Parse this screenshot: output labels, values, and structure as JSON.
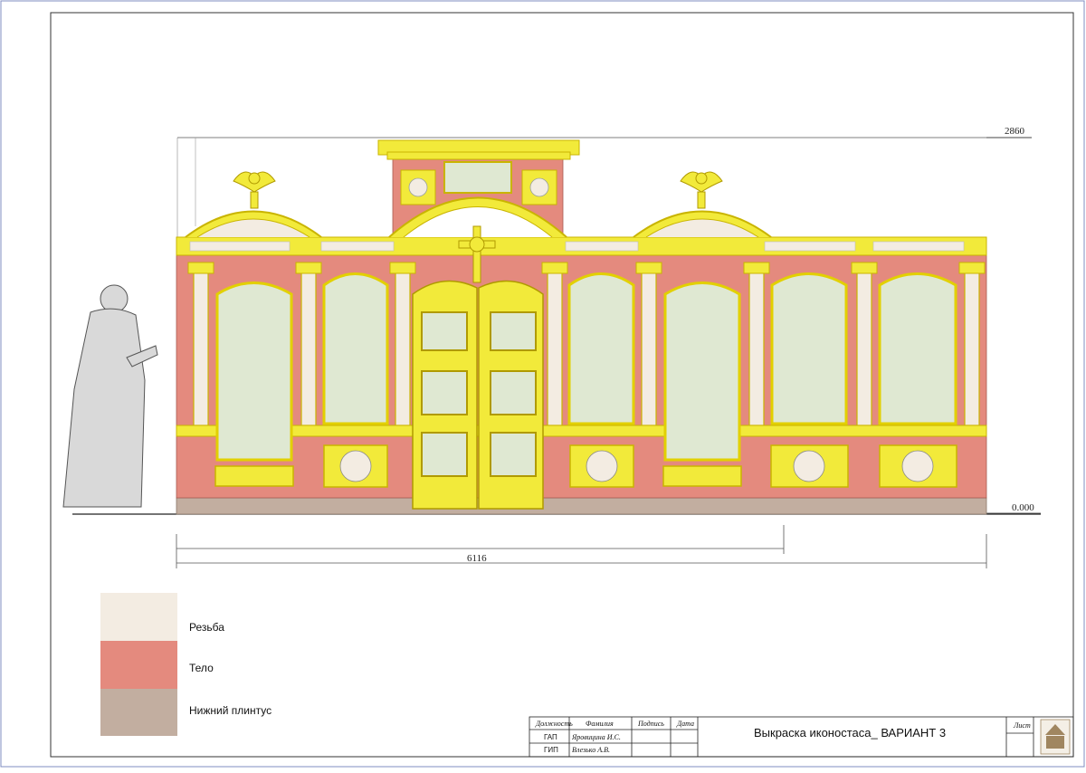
{
  "drawing": {
    "dim_height": "2860",
    "dim_zero": "0.000",
    "dim_width": "6116"
  },
  "legend": {
    "items": [
      {
        "label": "Резьба",
        "color": "#f3ece2"
      },
      {
        "label": "Тело",
        "color": "#e48a7e"
      },
      {
        "label": "Нижний плинтус",
        "color": "#c2aea0"
      }
    ]
  },
  "title_block": {
    "headers": [
      "Должность",
      "Фамилия",
      "Подпись",
      "Дата"
    ],
    "rows": [
      {
        "position": "ГАП",
        "name": "Яровицина И.С."
      },
      {
        "position": "ГИП",
        "name": "Влезько А.В."
      }
    ],
    "title": "Выкраска иконостаса_ ВАРИАНТ 3",
    "sheet_label": "Лист"
  },
  "colors": {
    "body": "#e48a7e",
    "gold": "#f2ea3a",
    "gold_dark": "#c9b400",
    "panel": "#dfe8d2",
    "carving": "#f3ece2",
    "plinth": "#c2aea0"
  }
}
